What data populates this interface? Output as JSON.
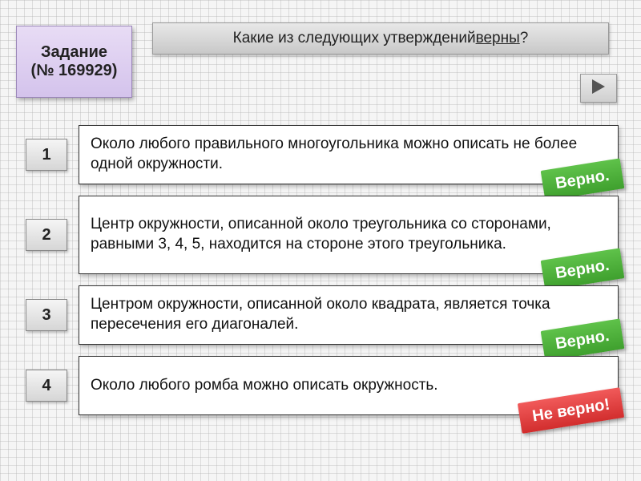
{
  "task": {
    "label_line1": "Задание",
    "label_line2": "(№ 169929)"
  },
  "question": {
    "prefix": "Какие из следующих утверждений ",
    "emph": "верны",
    "suffix": "?"
  },
  "options": [
    {
      "num": "1",
      "text": "Около любого правильного многоугольника можно описать не более одной окружности.",
      "badge": "Верно.",
      "correct": true
    },
    {
      "num": "2",
      "text": "Центр окружности, описанной около треугольника со сторонами, равными 3, 4, 5, находится на стороне этого треугольника.",
      "badge": "Верно.",
      "correct": true
    },
    {
      "num": "3",
      "text": "Центром окружности, описанной около квадрата, является точка пересечения его диагоналей.",
      "badge": "Верно.",
      "correct": true
    },
    {
      "num": "4",
      "text": "Около любого ромба можно описать окружность.",
      "badge": "Не верно!",
      "correct": false
    }
  ]
}
